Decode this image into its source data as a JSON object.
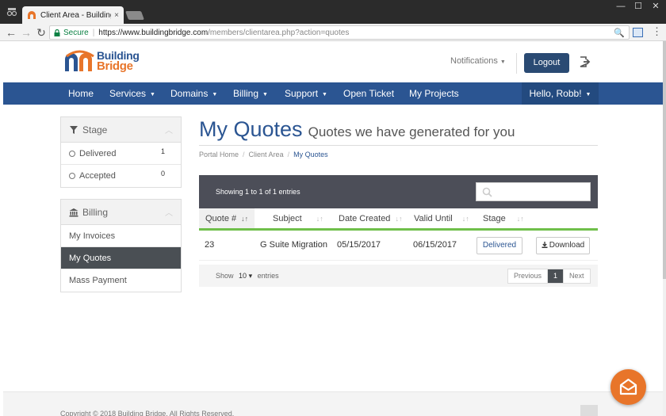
{
  "browser": {
    "tab_title": "Client Area - Building Bri",
    "tab_close": "×",
    "window_controls": [
      "—",
      "☐",
      "✕"
    ],
    "secure_label": "Secure",
    "url_host": "https://www.buildingbridge.com",
    "url_path": "/members/clientarea.php?action=quotes",
    "back_glyph": "←",
    "forward_glyph": "→",
    "reload_glyph": "↻",
    "menu_glyph": "⋮",
    "zoom_glyph": "🔍"
  },
  "header": {
    "logo_line1": "Building",
    "logo_line2": "Bridge",
    "notifications_label": "Notifications",
    "caret": "▼",
    "logout_label": "Logout"
  },
  "nav": {
    "items": [
      {
        "label": "Home",
        "caret": ""
      },
      {
        "label": "Services",
        "caret": "▼"
      },
      {
        "label": "Domains",
        "caret": "▼"
      },
      {
        "label": "Billing",
        "caret": "▼"
      },
      {
        "label": "Support",
        "caret": "▼"
      },
      {
        "label": "Open Ticket",
        "caret": ""
      },
      {
        "label": "My Projects",
        "caret": ""
      }
    ],
    "user_label": "Hello, Robb!",
    "user_caret": "▼"
  },
  "sidebar": {
    "stage_title": "Stage",
    "stage_items": [
      {
        "label": "Delivered",
        "count": "1"
      },
      {
        "label": "Accepted",
        "count": "0"
      }
    ],
    "billing_title": "Billing",
    "billing_items": [
      {
        "label": "My Invoices"
      },
      {
        "label": "My Quotes"
      },
      {
        "label": "Mass Payment"
      }
    ],
    "chevron": "︿"
  },
  "main": {
    "title": "My Quotes",
    "subtitle": "Quotes we have generated for you",
    "breadcrumb": [
      "Portal Home",
      "Client Area",
      "My Quotes"
    ],
    "breadcrumb_sep": "/",
    "showing_text": "Showing 1 to 1 of 1 entries",
    "columns": [
      "Quote #",
      "Subject",
      "Date Created",
      "Valid Until",
      "Stage"
    ],
    "sort_glyph": "↓↑",
    "rows": [
      {
        "quote": "23",
        "subject": "G Suite Migration",
        "created": "05/15/2017",
        "valid": "06/15/2017",
        "stage": "Delivered",
        "action": "Download"
      }
    ],
    "show_label": "Show",
    "entries_label": "entries",
    "length_value": "10",
    "length_caret": "▾",
    "pager": {
      "previous": "Previous",
      "page": "1",
      "next": "Next"
    }
  },
  "footer": {
    "copyright": "Copyright © 2018 Building Bridge. All Rights Reserved."
  },
  "colors": {
    "brand_blue": "#2b5592",
    "brand_orange": "#e8752a",
    "accent_green": "#6fbf4a",
    "table_header_dark": "#4c4e58"
  }
}
